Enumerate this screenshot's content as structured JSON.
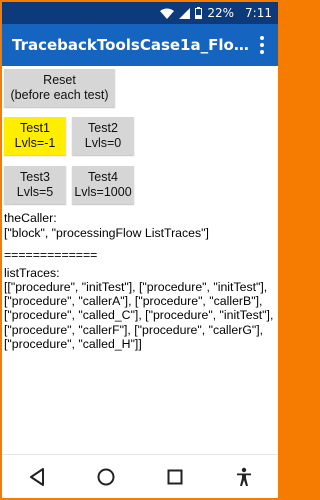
{
  "status_bar": {
    "battery": "22%",
    "time": "7:11"
  },
  "app_bar": {
    "title": "TracebackToolsCase1a_Flow1..."
  },
  "buttons": {
    "reset": {
      "line1": "Reset",
      "line2": "(before each test)"
    },
    "test1": {
      "line1": "Test1",
      "line2": "Lvls=-1"
    },
    "test2": {
      "line1": "Test2",
      "line2": "Lvls=0"
    },
    "test3": {
      "line1": "Test3",
      "line2": "Lvls=5"
    },
    "test4": {
      "line1": "Test4",
      "line2": "Lvls=1000"
    }
  },
  "output": {
    "caller_label": "theCaller:",
    "caller_value": "[\"block\", \"processingFlow ListTraces\"]",
    "separator": "=============",
    "list_label": "listTraces:",
    "list_value": "[[\"procedure\", \"initTest\"], [\"procedure\", \"initTest\"], [\"procedure\", \"callerA\"], [\"procedure\", \"callerB\"], [\"procedure\", \"called_C\"], [\"procedure\", \"initTest\"], [\"procedure\", \"callerF\"], [\"procedure\", \"callerG\"], [\"procedure\", \"called_H\"]]"
  },
  "colors": {
    "status_bar": "#0d3a7a",
    "app_bar": "#1565c0",
    "highlight": "#ffee00",
    "button": "#d6d6d6",
    "frame": "#f57c00"
  },
  "icons": {
    "status": [
      "wifi-icon",
      "signal-icon",
      "battery-icon"
    ],
    "nav": [
      "back-icon",
      "home-icon",
      "recents-icon",
      "accessibility-icon"
    ],
    "app_bar": "overflow-menu-icon"
  }
}
